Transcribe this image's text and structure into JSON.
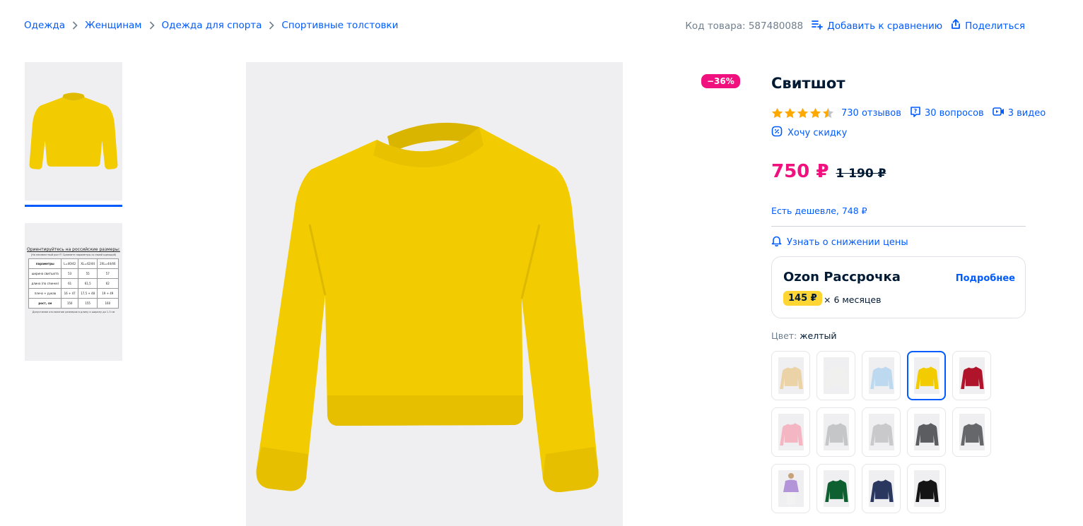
{
  "breadcrumb": {
    "items": [
      "Одежда",
      "Женщинам",
      "Одежда для спорта",
      "Спортивные толстовки"
    ]
  },
  "header_actions": {
    "product_code": "Код товара: 587480088",
    "compare_label": "Добавить к сравнению",
    "share_label": "Поделиться"
  },
  "size_chart": {
    "title": "Ориентируйтесь на российские размеры:",
    "note": "(На неизвестный рост?! Сравните параметры со своей одеждой)",
    "headers": [
      "параметры",
      "L=40/42",
      "XL=42/44",
      "2XL=44/46"
    ],
    "rows": [
      [
        "ширина свитшота",
        "53",
        "55",
        "57"
      ],
      [
        "длина (по спинке)",
        "61",
        "61,5",
        "62"
      ],
      [
        "плечо + рукав",
        "16 + 47",
        "17,5 + 48",
        "19 + 49"
      ],
      [
        "рост, см",
        "150",
        "155",
        "160"
      ]
    ],
    "footnote": "Допустимое отклонение размеров в длину и ширину до 1-3 см"
  },
  "product": {
    "discount_badge": "−36%",
    "title": "Свитшот",
    "rating": 4.5,
    "reviews_label": "730 отзывов",
    "questions_label": "30 вопросов",
    "videos_label": "3 видео",
    "wish_discount_label": "Хочу скидку",
    "price": "750 ₽",
    "old_price": "1 190 ₽",
    "cheaper_label": "Есть дешевле, 748 ₽",
    "price_drop_label": "Узнать о снижении цены"
  },
  "installment": {
    "title": "Ozon Рассрочка",
    "more_label": "Подробнее",
    "monthly": "145 ₽",
    "months_label": "× 6 месяцев"
  },
  "color": {
    "label": "Цвет:",
    "selected": "желтый",
    "swatches": [
      {
        "color": "#ecd3a7",
        "type": "sweater"
      },
      {
        "color": "#f0f0ee",
        "type": "sweater"
      },
      {
        "color": "#bcd9f0",
        "type": "sweater"
      },
      {
        "color": "#f2cc00",
        "type": "sweater",
        "selected": true
      },
      {
        "color": "#b0142b",
        "type": "sweater"
      },
      {
        "color": "#f5b6c4",
        "type": "sweater"
      },
      {
        "color": "#c5c6c8",
        "type": "sweater"
      },
      {
        "color": "#c9c9cb",
        "type": "sweater"
      },
      {
        "color": "#5c5d60",
        "type": "sweater"
      },
      {
        "color": "#66676a",
        "type": "sweater"
      },
      {
        "color": "#b494d8",
        "type": "model"
      },
      {
        "color": "#0e6030",
        "type": "sweater"
      },
      {
        "color": "#2a3860",
        "type": "sweater"
      },
      {
        "color": "#141414",
        "type": "sweater"
      }
    ]
  },
  "colors": {
    "accent": "#005bff",
    "sale": "#f1117e",
    "star": "#ffa800",
    "product": "#f2cc00",
    "installment_badge": "#ffd533"
  }
}
